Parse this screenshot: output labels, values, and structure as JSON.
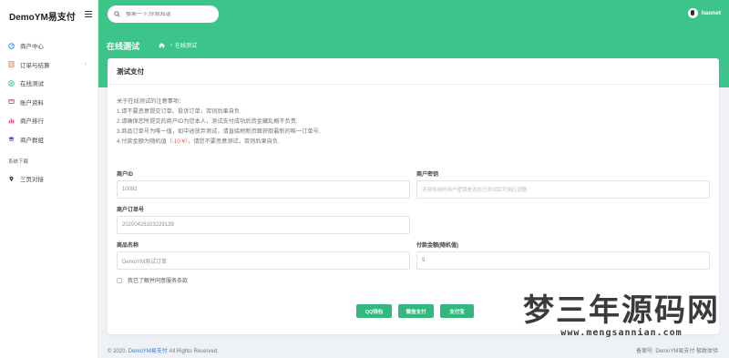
{
  "brand": {
    "name": "DemoYM易支付"
  },
  "sidebar": {
    "items": [
      {
        "label": "商户中心",
        "icon": "dashboard-icon",
        "color": "#3d8ef0"
      },
      {
        "label": "订单与结算",
        "icon": "order-icon",
        "color": "#e8792e",
        "chevron": "›"
      },
      {
        "label": "在线测试",
        "icon": "test-icon",
        "color": "#3cc48b"
      },
      {
        "label": "账户资料",
        "icon": "profile-icon",
        "color": "#e0507a"
      },
      {
        "label": "商户排行",
        "icon": "rank-icon",
        "color": "#e0507a"
      },
      {
        "label": "商户群组",
        "icon": "group-icon",
        "color": "#4353c4"
      }
    ],
    "section_label": "系统下载",
    "extra_items": [
      {
        "label": "三页对接",
        "icon": "pin-icon",
        "color": "#2b2b2b"
      }
    ]
  },
  "search": {
    "placeholder": "搜索一下,你就知道"
  },
  "user": {
    "name": "haonet"
  },
  "header": {
    "title": "在线测试",
    "breadcrumb": "在线测试"
  },
  "card": {
    "title": "测试支付",
    "notes": [
      "关于在线测试的注意事项：",
      "1.请不要恶意提交订单、投诉订单，否则后果自负.",
      "2.请确保您所提交的商户ID为您本人，测试支付成功后资金藏乱概不负责.",
      "3.商品订单号为唯一值，如中途放弃测试，请直接刷新页面获取最新的唯一订单号.",
      "4.付款金额为随机值",
      "（-10 ¥）",
      "，请您不要恶意测试，否则后果自负."
    ],
    "fields": {
      "merchant_id": {
        "label": "商户ID",
        "value": "10092"
      },
      "merchant_key": {
        "label": "商户密钥",
        "placeholder": "还穿即用的商户密钥是否在已测试后可用应调整"
      },
      "order_no": {
        "label": "商户订单号",
        "value": "20200426103229139"
      },
      "product_name": {
        "label": "商品名称",
        "value": "DemoYM测试订单"
      },
      "amount": {
        "label": "付款金额(随机值)",
        "value": "9"
      }
    },
    "agree_label": "我已了解并同意服务条款",
    "buttons": {
      "qq": "QQ钱包",
      "wechat": "微信支付",
      "alipay": "支付宝"
    }
  },
  "footer": {
    "copyright_prefix": "© 2020.",
    "brand_link": "DemoYM易支付",
    "copyright_suffix": "All Rights Reserved.",
    "right_text": "备案号: DemoYM易支付 极致体验"
  },
  "watermark": {
    "title": "梦三年源码网",
    "url": "www.mengsannian.com"
  },
  "colors": {
    "primary": "#3cc48b",
    "button": "#31b97d",
    "link": "#2e7cd1"
  }
}
